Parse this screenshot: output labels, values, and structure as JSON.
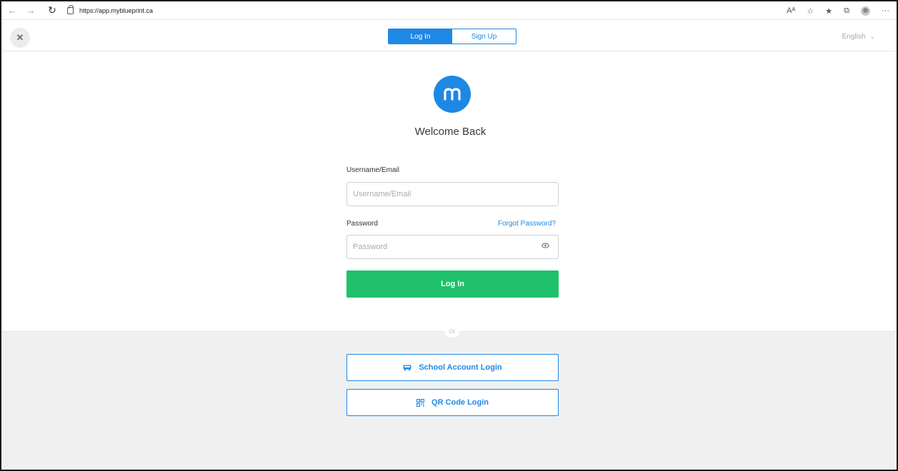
{
  "browser": {
    "url": "https://app.myblueprint.ca",
    "back_icon": "back-arrow-icon",
    "forward_icon": "forward-arrow-icon",
    "reload_icon": "reload-icon",
    "read_aloud_icon": "read-aloud-icon",
    "read_aloud_label": "Aᴬ",
    "favorite_icon": "add-favorite-icon",
    "favorites_icon": "favorites-icon",
    "collections_icon": "collections-icon",
    "more_label": "···"
  },
  "header": {
    "close_label": "✕",
    "tabs": [
      {
        "label": "Log In",
        "active": true
      },
      {
        "label": "Sign Up",
        "active": false
      }
    ],
    "language": "English",
    "language_chevron": "⌄"
  },
  "main": {
    "welcome": "Welcome Back",
    "username": {
      "label": "Username/Email",
      "placeholder": "Username/Email",
      "value": ""
    },
    "password": {
      "label": "Password",
      "placeholder": "Password",
      "value": ""
    },
    "forgot": "Forgot Password?",
    "login_button": "Log In",
    "or": "Or",
    "school_login": "School Account Login",
    "qr_login": "QR Code Login"
  },
  "colors": {
    "primary": "#1e88e5",
    "success": "#1fc16b",
    "lower_bg": "#f0f0f0"
  }
}
